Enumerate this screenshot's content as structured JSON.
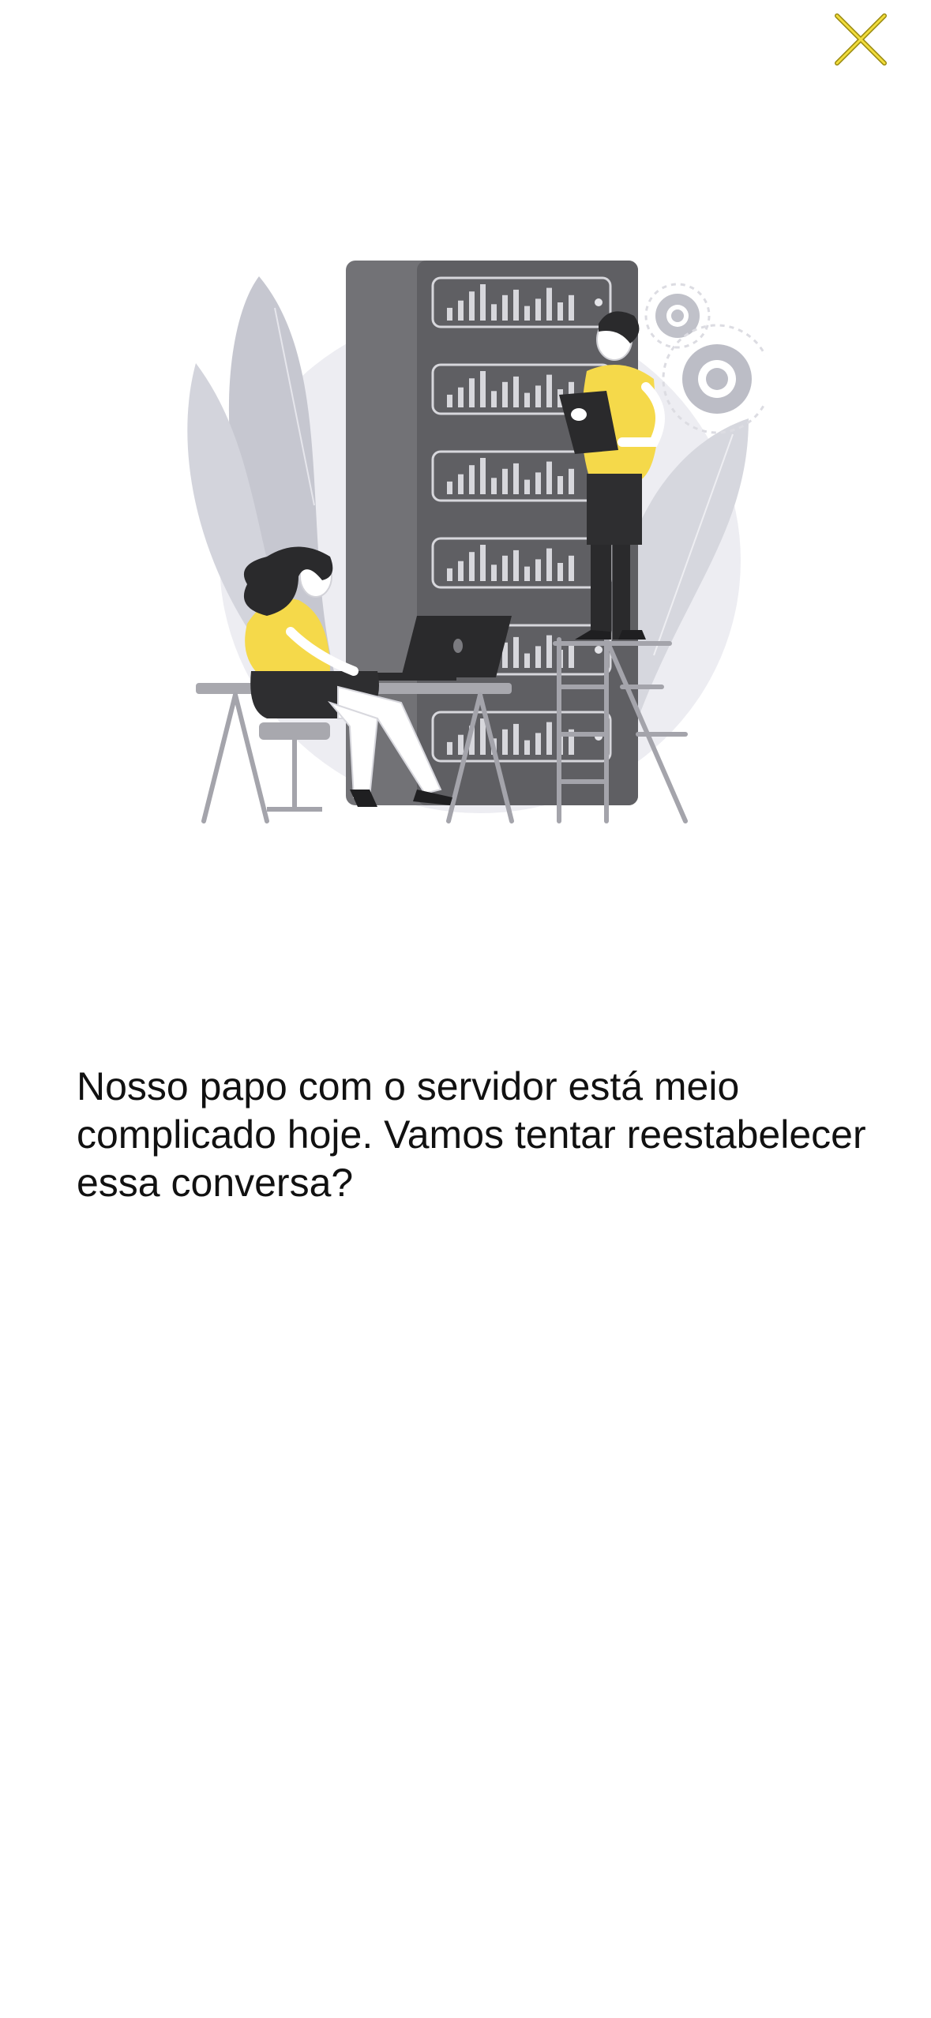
{
  "close_button": {
    "icon": "close-icon",
    "color": "#F2DD3C"
  },
  "illustration": {
    "accent_color": "#F5D94A",
    "server_color": "#5F5F63",
    "people": [
      "woman-at-laptop",
      "man-on-ladder-with-clipboard"
    ]
  },
  "error": {
    "message": "Nosso papo com o servidor está meio complicado hoje. Vamos tentar reestabelecer essa conversa?"
  }
}
